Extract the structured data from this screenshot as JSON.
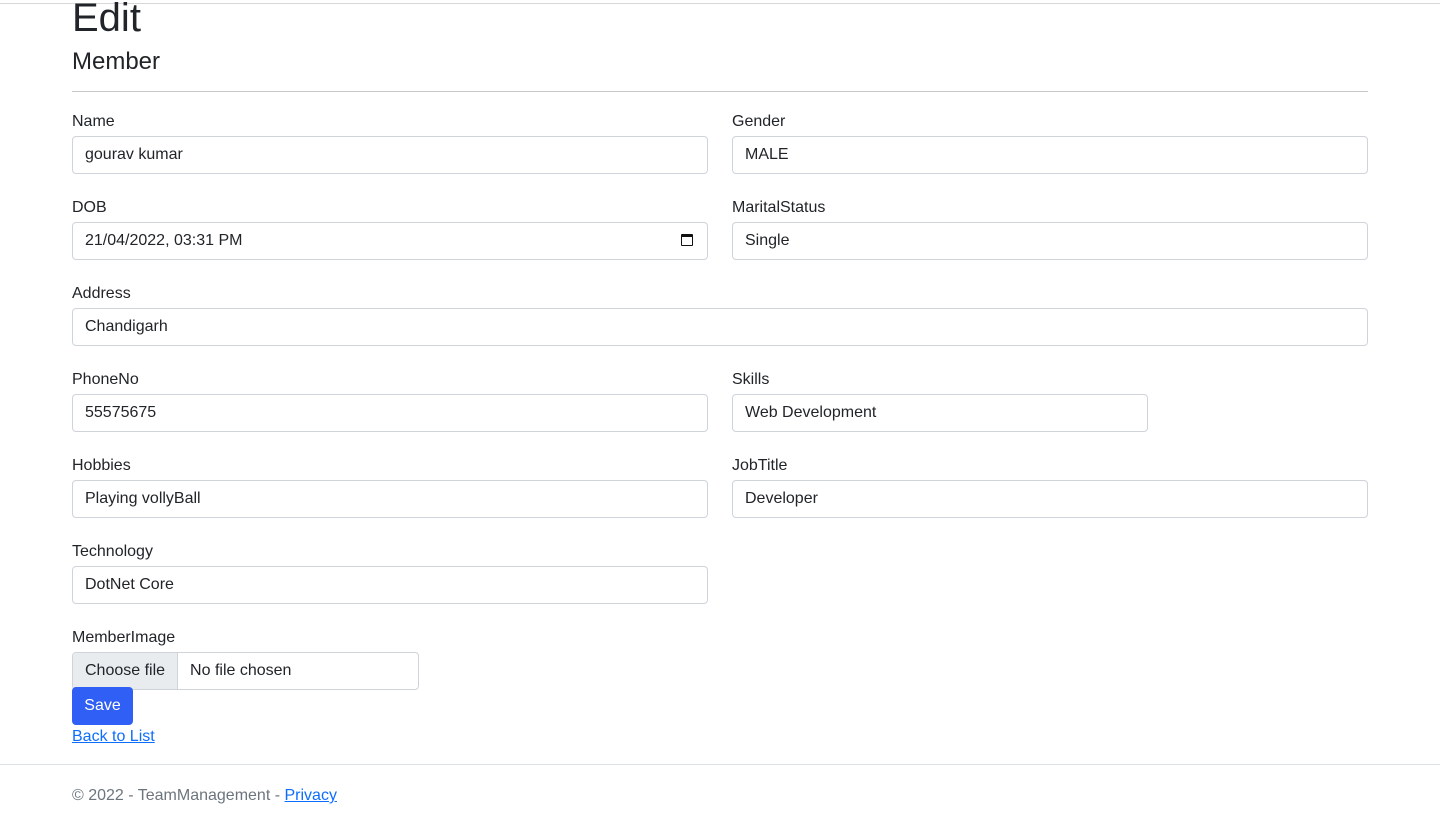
{
  "page": {
    "title": "Edit",
    "subtitle": "Member"
  },
  "form": {
    "name": {
      "label": "Name",
      "value": "gourav kumar"
    },
    "gender": {
      "label": "Gender",
      "value": "MALE"
    },
    "dob": {
      "label": "DOB",
      "value": "21/04/2022, 03:31 PM",
      "icon": "calendar-icon"
    },
    "marital_status": {
      "label": "MaritalStatus",
      "value": "Single"
    },
    "address": {
      "label": "Address",
      "value": "Chandigarh"
    },
    "phone": {
      "label": "PhoneNo",
      "value": "55575675"
    },
    "skills": {
      "label": "Skills",
      "value": "Web Development"
    },
    "hobbies": {
      "label": "Hobbies",
      "value": "Playing vollyBall"
    },
    "job_title": {
      "label": "JobTitle",
      "value": "Developer"
    },
    "technology": {
      "label": "Technology",
      "value": "DotNet Core"
    },
    "member_image": {
      "label": "MemberImage",
      "button": "Choose file",
      "status": "No file chosen"
    },
    "save_label": "Save",
    "back_link": "Back to List"
  },
  "footer": {
    "text": "© 2022 - TeamManagement - ",
    "privacy": "Privacy"
  }
}
